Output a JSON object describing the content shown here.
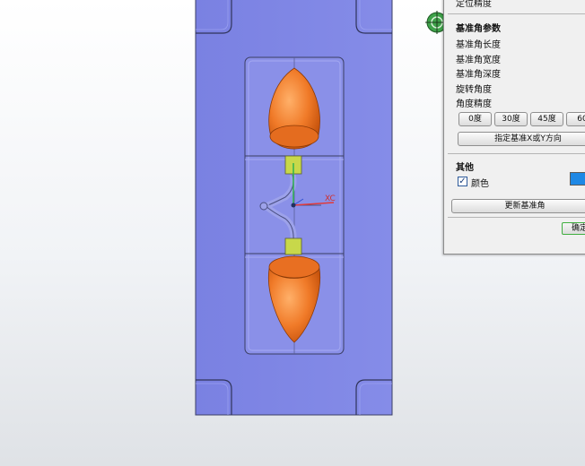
{
  "panel": {
    "top_cut_label": "定位精度",
    "datum_section_title": "基准角参数",
    "fields": [
      "基准角长度",
      "基准角宽度",
      "基准角深度",
      "旋转角度",
      "角度精度"
    ],
    "angle_buttons": [
      "0度",
      "30度",
      "45度",
      "60"
    ],
    "direction_button": "指定基准X或Y方向",
    "other_section_title": "其他",
    "color_checkbox_label": "颜色",
    "color_checked": true,
    "color_value": "#1e88e5",
    "update_button": "更新基准角",
    "ok_button": "确定"
  },
  "viewport": {
    "axis_label": "XC",
    "mold_plate_color": "#7f86e6",
    "part_color": "#f07a28"
  }
}
